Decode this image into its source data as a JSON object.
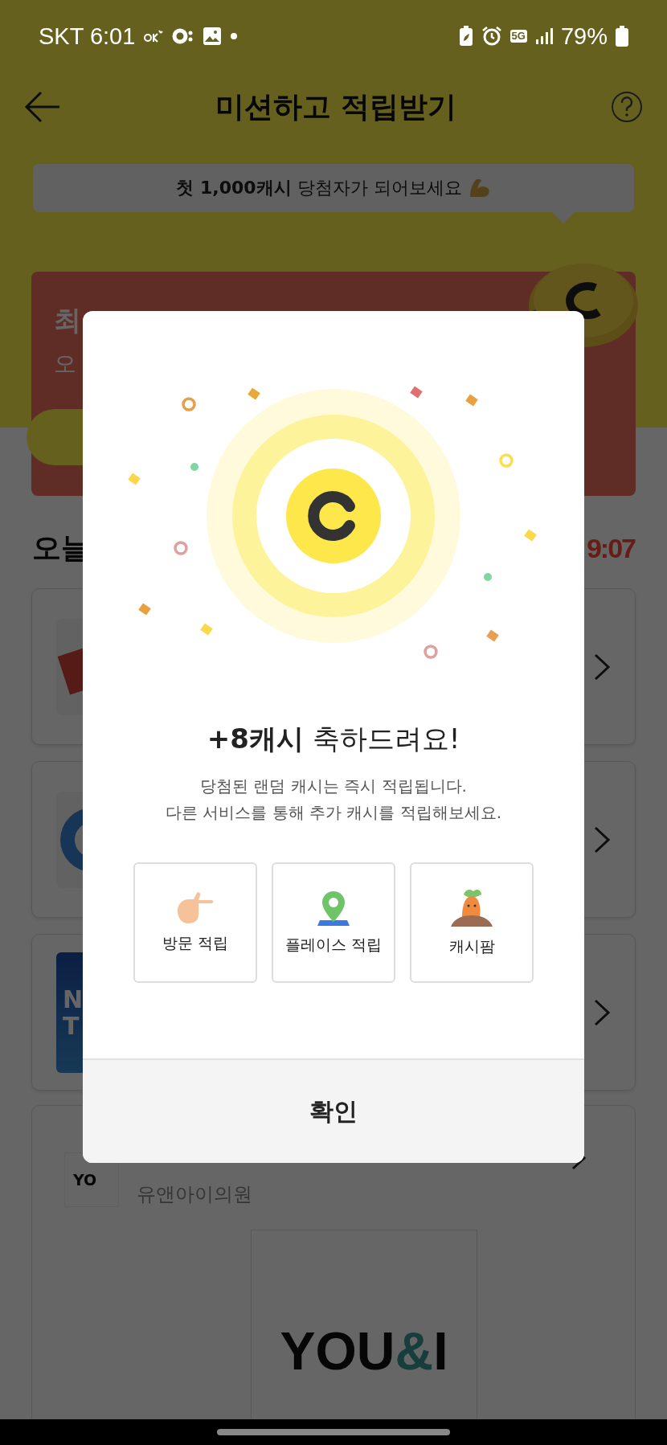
{
  "status_bar": {
    "carrier_time": "SKT 6:01",
    "network": "5G",
    "battery": "79%"
  },
  "header": {
    "title": "미션하고 적립받기"
  },
  "banner": {
    "text": "**첫 1,000캐시** 당첨자가 되어보세요"
  },
  "promo_card": {
    "title": "최",
    "subtitle": "오"
  },
  "section": {
    "title": "오늘",
    "timer": "9:07"
  },
  "list": [
    {
      "kind": "tilted"
    },
    {
      "kind": "circle"
    },
    {
      "kind": "text-logo",
      "logo_lines": [
        "N",
        "T"
      ]
    }
  ],
  "featured": {
    "logo_text": "YO",
    "subtitle": "유앤아이의원",
    "image_logo": [
      {
        "text": "YOU",
        "accent": false
      },
      {
        "text": "&",
        "accent": true
      },
      {
        "text": "I",
        "accent": false
      }
    ]
  },
  "modal": {
    "title": "**+8캐시** 축하드려요!",
    "description": [
      "당첨된 랜덤 캐시는 즉시 적립됩니다.",
      "다른 서비스를 통해 추가 캐시를 적립해보세요."
    ],
    "shortcuts": [
      {
        "kind": "visit",
        "label": "방문 적립"
      },
      {
        "kind": "place",
        "label": "플레이스 적립"
      },
      {
        "kind": "farm",
        "label": "캐시팜"
      }
    ],
    "confirm": "확인"
  }
}
